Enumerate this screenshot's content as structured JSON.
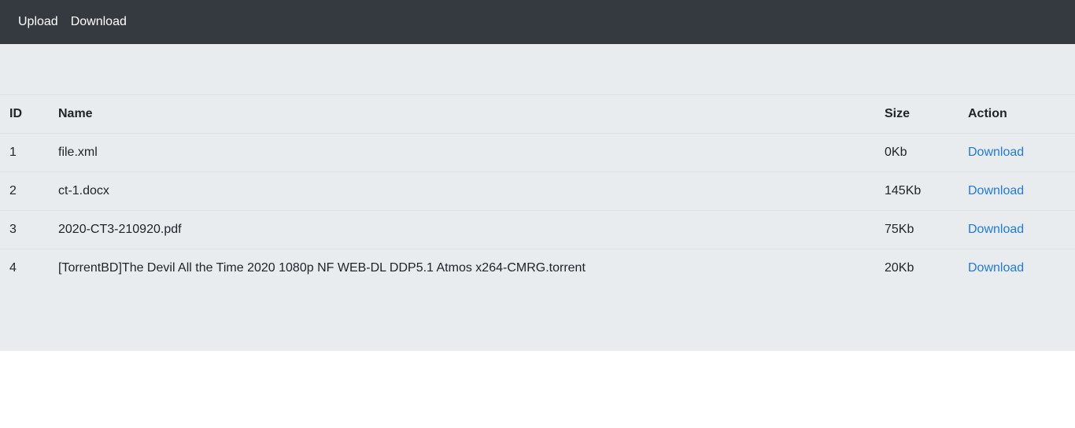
{
  "nav": {
    "items": [
      {
        "label": "Upload"
      },
      {
        "label": "Download"
      }
    ]
  },
  "table": {
    "headers": {
      "id": "ID",
      "name": "Name",
      "size": "Size",
      "action": "Action"
    },
    "rows": [
      {
        "id": "1",
        "name": "file.xml",
        "size": "0Kb",
        "action": "Download"
      },
      {
        "id": "2",
        "name": "ct-1.docx",
        "size": "145Kb",
        "action": "Download"
      },
      {
        "id": "3",
        "name": "2020-CT3-210920.pdf",
        "size": "75Kb",
        "action": "Download"
      },
      {
        "id": "4",
        "name": "[TorrentBD]The Devil All the Time 2020 1080p NF WEB-DL DDP5.1 Atmos x264-CMRG.torrent",
        "size": "20Kb",
        "action": "Download"
      }
    ]
  },
  "colors": {
    "navbar": "#343a40",
    "panel": "#e9ecef",
    "link": "#1f7ae0"
  }
}
